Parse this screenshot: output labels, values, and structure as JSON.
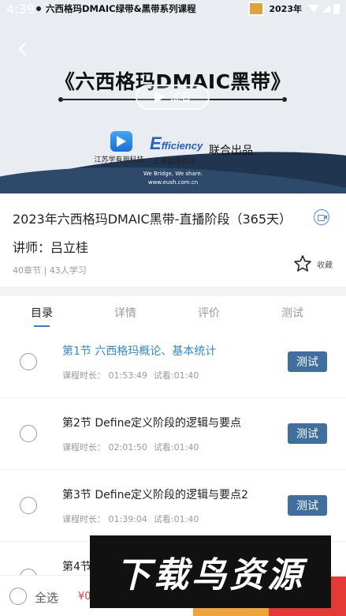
{
  "status_bar": {
    "time": "4:39",
    "notification_title": "六西格玛DMAIC绿带&黑带系列课程",
    "year_text": "2023年"
  },
  "banner": {
    "title": "《六西格玛DMAIC黑带》",
    "preview_label": "试看",
    "logo1_label": "江苏学有用科技",
    "logo2_word": "fficiency",
    "logo2_initial": "E",
    "logo2_label": "上海益旭咨询",
    "joint_text": "联合出品",
    "slogan_line1": "We Bridge, We share.",
    "slogan_line2": "www.eush.com.cn"
  },
  "course": {
    "title": "2023年六西格玛DMAIC黑带-直播阶段（365天）",
    "teacher": "讲师：吕立桂",
    "meta": "40章节 | 43人学习",
    "favorite_label": "收藏"
  },
  "tabs": [
    "目录",
    "详情",
    "评价",
    "测试"
  ],
  "lessons": [
    {
      "name": "第1节 六西格玛概论、基本统计",
      "duration": "课程时长：  01:53:49",
      "trial": "试看:01:40",
      "test": "测试"
    },
    {
      "name": "第2节 Define定义阶段的逻辑与要点",
      "duration": "课程时长：  02:01:50",
      "trial": "试看:01:40",
      "test": "测试"
    },
    {
      "name": "第3节 Define定义阶段的逻辑与要点2",
      "duration": "课程时长：  01:39:04",
      "trial": "试看:01:40",
      "test": "测试"
    },
    {
      "name": "第4节",
      "duration": "",
      "trial": "",
      "test": ""
    }
  ],
  "bottom": {
    "select_all": "全选",
    "price": "¥0"
  },
  "watermark": "下载鸟资源",
  "colors": {
    "accent_blue": "#2f8ad8",
    "test_button": "#3f6f9e",
    "cta_orange": "#f3a33a",
    "cta_red": "#e53935"
  }
}
